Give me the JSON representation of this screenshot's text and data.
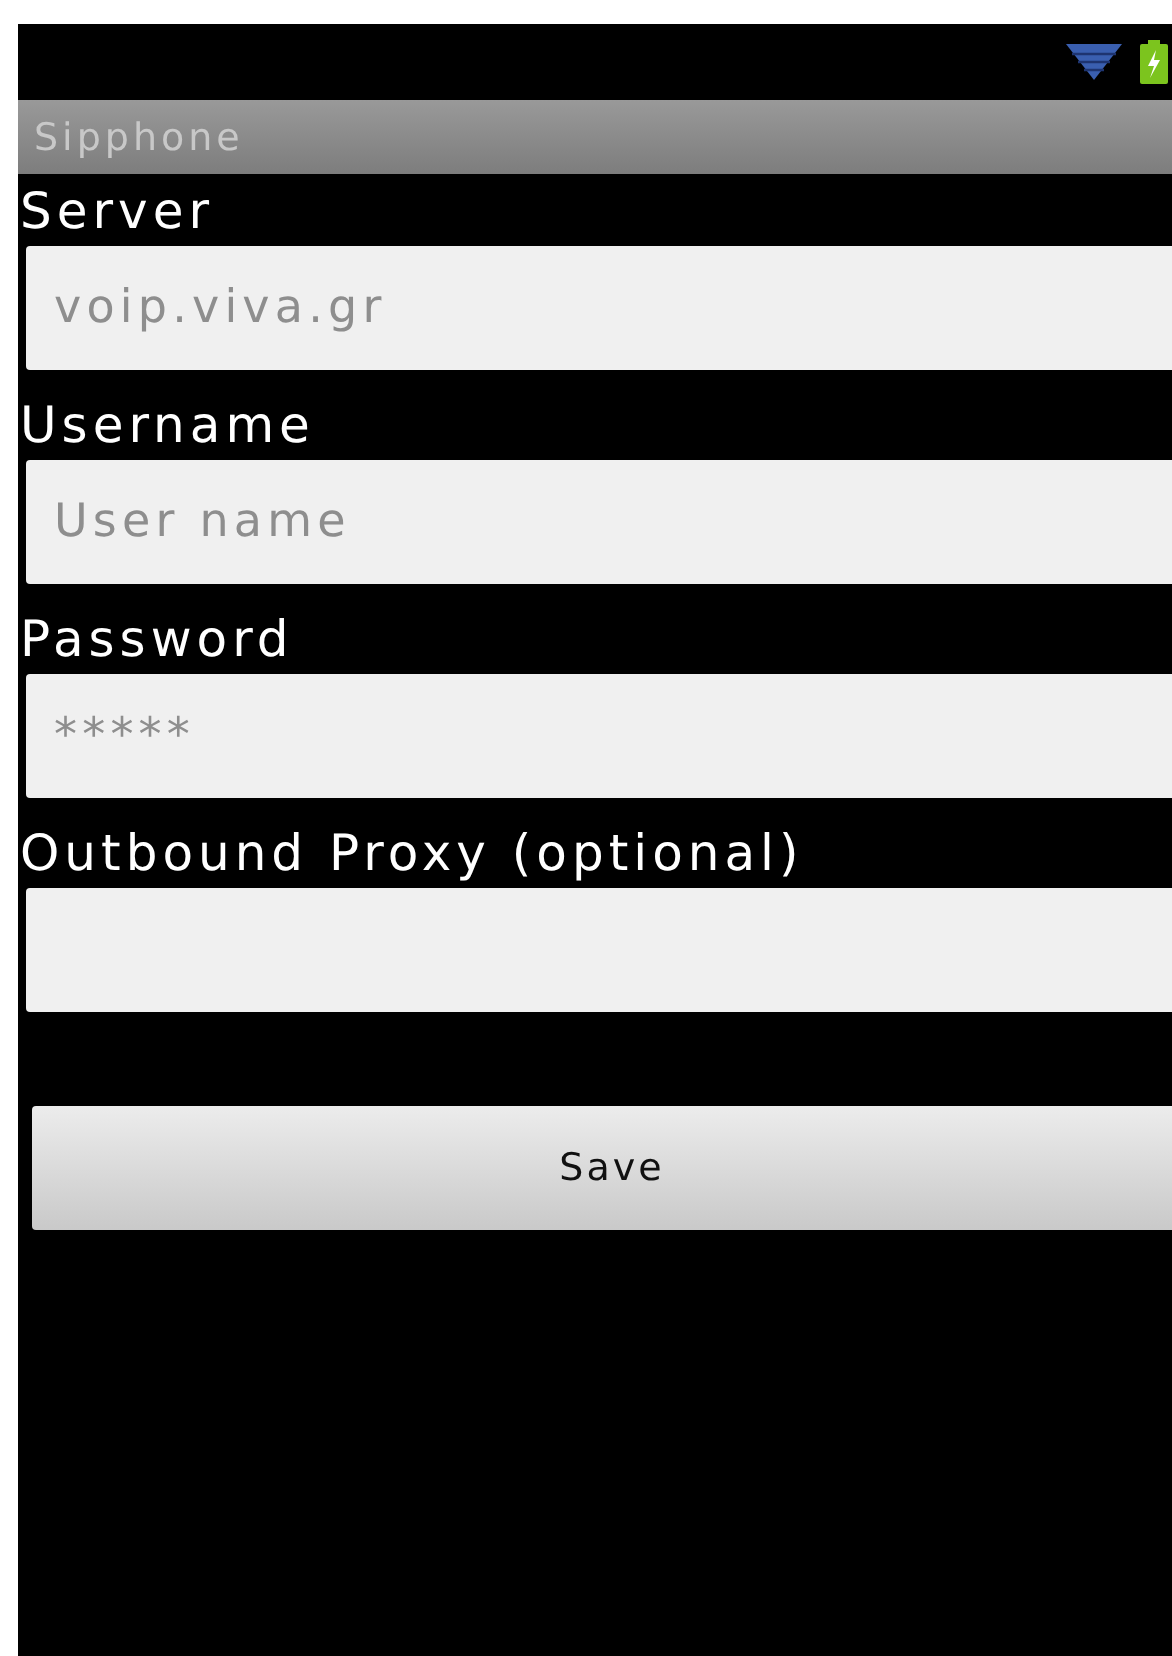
{
  "window": {
    "title": "Sipphone"
  },
  "fields": [
    {
      "label": "Server",
      "placeholder": "voip.viva.gr"
    },
    {
      "label": "Username",
      "placeholder": "User name"
    },
    {
      "label": "Password",
      "placeholder": "*****"
    },
    {
      "label": "Outbound Proxy (optional)"
    }
  ],
  "buttons": [
    "Save"
  ]
}
